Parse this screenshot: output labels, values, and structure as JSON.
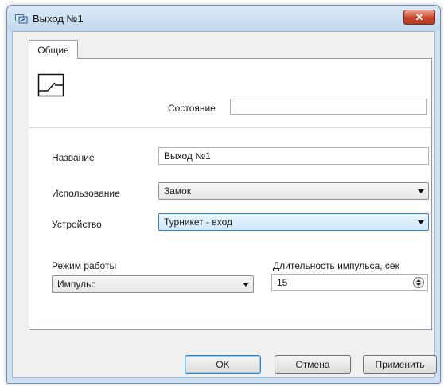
{
  "window": {
    "title": "Выход №1",
    "close_label": "✕"
  },
  "tabs": [
    {
      "label": "Общие"
    }
  ],
  "state": {
    "label": "Состояние",
    "value": ""
  },
  "form": {
    "name_label": "Название",
    "name_value": "Выход №1",
    "usage_label": "Использование",
    "usage_value": "Замок",
    "device_label": "Устройство",
    "device_value": "Турникет - вход",
    "mode_label": "Режим работы",
    "mode_value": "Импульс",
    "pulse_label": "Длительность импульса, сек",
    "pulse_value": "15"
  },
  "buttons": {
    "ok": "OK",
    "cancel": "Отмена",
    "apply": "Применить"
  },
  "icons": {
    "app": "relay-output-icon",
    "device": "switch-symbol-icon"
  },
  "colors": {
    "title_bg": "#c3d8ee",
    "close_red": "#c7462d",
    "accent": "#3c7fb1"
  }
}
